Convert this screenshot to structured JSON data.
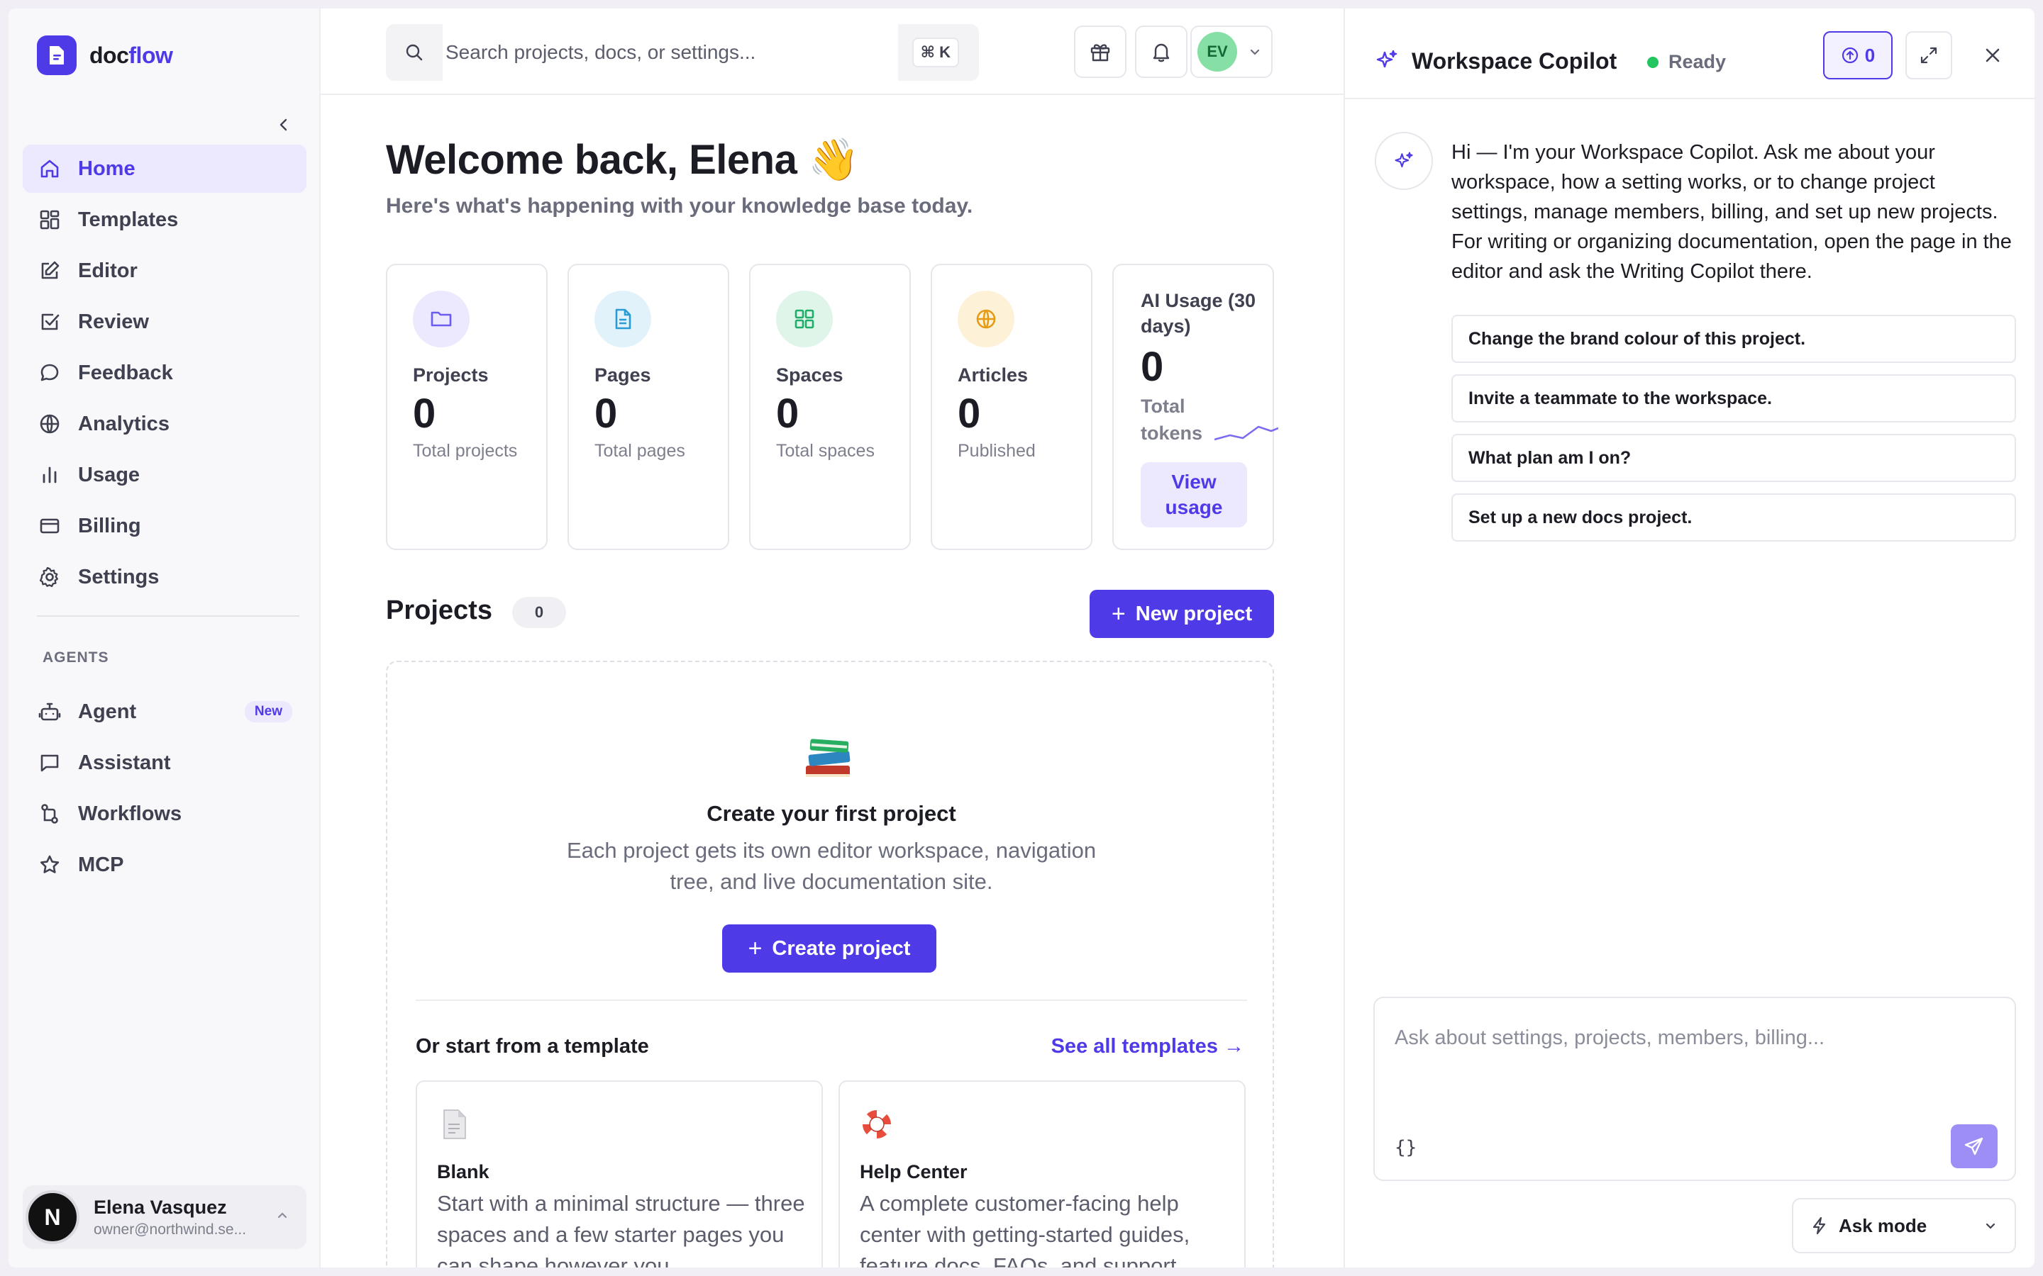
{
  "brand": {
    "name_prefix": "doc",
    "name_accent": "flow",
    "color": "#4f3ae8"
  },
  "sidebar": {
    "items": [
      {
        "label": "Home",
        "icon": "home-icon",
        "active": true
      },
      {
        "label": "Templates",
        "icon": "grid-icon"
      },
      {
        "label": "Editor",
        "icon": "edit-icon"
      },
      {
        "label": "Review",
        "icon": "check-square-icon"
      },
      {
        "label": "Feedback",
        "icon": "chat-bubble-icon"
      },
      {
        "label": "Analytics",
        "icon": "globe-icon"
      },
      {
        "label": "Usage",
        "icon": "bar-chart-icon"
      },
      {
        "label": "Billing",
        "icon": "credit-card-icon"
      },
      {
        "label": "Settings",
        "icon": "gear-icon"
      }
    ],
    "section_label": "AGENTS",
    "agents": [
      {
        "label": "Agent",
        "icon": "robot-icon",
        "badge": "New"
      },
      {
        "label": "Assistant",
        "icon": "message-square-icon"
      },
      {
        "label": "Workflows",
        "icon": "workflow-icon"
      },
      {
        "label": "MCP",
        "icon": "star-icon"
      }
    ],
    "user": {
      "initial": "N",
      "name": "Elena Vasquez",
      "email": "owner@northwind.se..."
    }
  },
  "topbar": {
    "search_placeholder": "Search projects, docs, or settings...",
    "shortcut": "⌘ K",
    "avatar_initials": "EV"
  },
  "main": {
    "welcome": "Welcome back, Elena 👋",
    "subtitle": "Here's what's happening with your knowledge base today.",
    "stats": [
      {
        "label": "Projects",
        "value": "0",
        "sub": "Total projects",
        "icon": "folder-icon",
        "color": "#6b5cf0",
        "bg": "#ece8fd"
      },
      {
        "label": "Pages",
        "value": "0",
        "sub": "Total pages",
        "icon": "file-icon",
        "color": "#2b9bd6",
        "bg": "#e1f2fb"
      },
      {
        "label": "Spaces",
        "value": "0",
        "sub": "Total spaces",
        "icon": "grid-icon",
        "color": "#1fae6a",
        "bg": "#dff5e9"
      },
      {
        "label": "Articles",
        "value": "0",
        "sub": "Published",
        "icon": "globe-icon",
        "color": "#e59b14",
        "bg": "#fdf2d8"
      }
    ],
    "ai_usage": {
      "label": "AI Usage (30 days)",
      "value": "0",
      "sub": "Total tokens",
      "button": "View usage"
    },
    "projects": {
      "title": "Projects",
      "count": "0",
      "new_button": "New project"
    },
    "empty": {
      "title": "Create your first project",
      "description": "Each project gets its own editor workspace, navigation tree, and live documentation site.",
      "button": "Create project",
      "template_heading": "Or start from a template",
      "see_all": "See all templates →",
      "templates": [
        {
          "name": "Blank",
          "icon": "document-icon",
          "description": "Start with a minimal structure — three spaces and a few starter pages you can shape however you"
        },
        {
          "name": "Help Center",
          "icon": "lifebuoy-icon",
          "description": "A complete customer-facing help center with getting-started guides, feature docs, FAQs, and support"
        }
      ]
    }
  },
  "copilot": {
    "title": "Workspace Copilot",
    "status": "Ready",
    "credits": "0",
    "message": "Hi — I'm your Workspace Copilot. Ask me about your workspace, how a setting works, or to change project settings, manage members, billing, and set up new projects. For writing or organizing documentation, open the page in the editor and ask the Writing Copilot there.",
    "suggestions": [
      "Change the brand colour of this project.",
      "Invite a teammate to the workspace.",
      "What plan am I on?",
      "Set up a new docs project."
    ],
    "input_placeholder": "Ask about settings, projects, members, billing...",
    "braces": "{}",
    "mode": "Ask mode"
  }
}
